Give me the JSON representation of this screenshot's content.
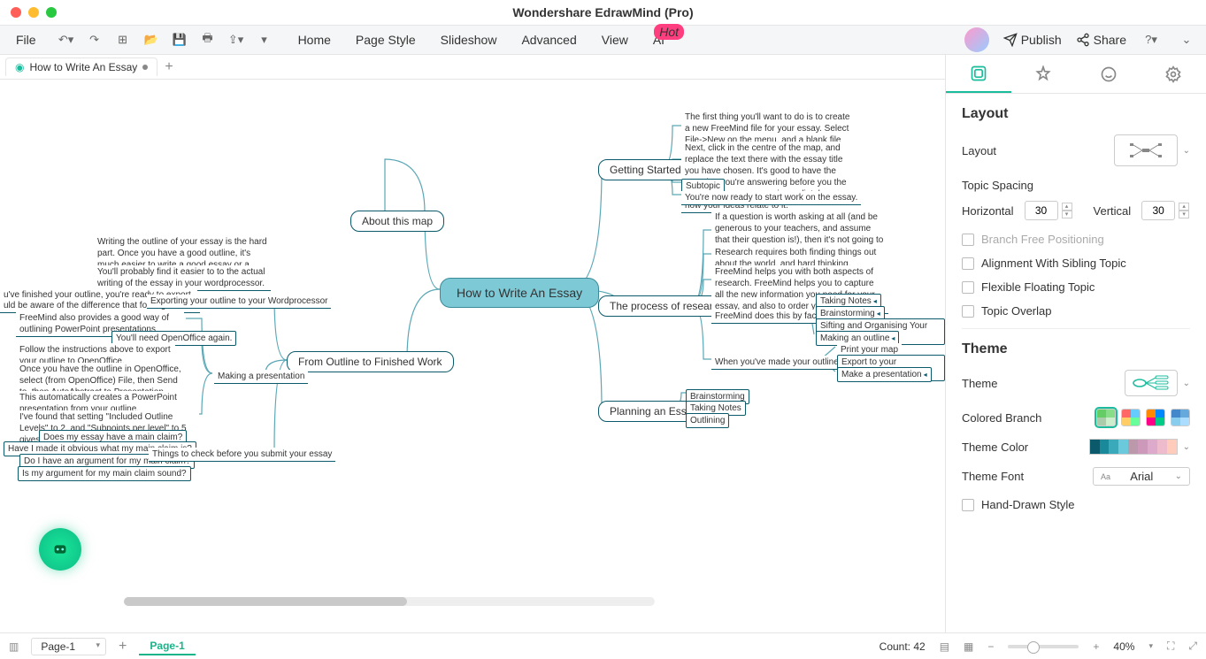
{
  "app_title": "Wondershare EdrawMind (Pro)",
  "toolbar": {
    "file": "File",
    "menu": [
      "Home",
      "Page Style",
      "Slideshow",
      "Advanced",
      "View",
      "AI"
    ],
    "hot": "Hot",
    "publish": "Publish",
    "share": "Share"
  },
  "tab": {
    "title": "How to Write An Essay"
  },
  "map": {
    "center": "How to Write An Essay",
    "about": "About this map",
    "outline": "From Outline to Finished Work",
    "getting": "Getting Started",
    "process": "The process of research",
    "planning": "Planning an Essay",
    "left": {
      "l1": "Writing the outline of your essay is the hard part. Once you have a good outline, it's much easier to write a good essay or a good presentation.",
      "l2": "You'll probably find it easier to to the actual writing of the essay in your wordprocessor.",
      "l3": "u've finished your outline, you're ready to export.",
      "l3b": "uld be aware of the difference that folding makes.",
      "l4": "Exporting your outline to your Wordprocessor",
      "l5": "FreeMind also provides a good way of outlining PowerPoint presentations.",
      "l6": "You'll need OpenOffice again.",
      "l7": "Follow the instructions above to export your outline to OpenOffice.",
      "l8": "Once you have the outline in OpenOffice, select (from OpenOffice) File, then Send to, then AutoAbstract to Presentation.",
      "l9": "This automatically creates a PowerPoint presentation from your outline.",
      "l10": "I've found that setting \"Included Outline Levels\" to 2, and \"Subpoints per level\" to 5 gives the best results.",
      "lmp": "Making a presentation",
      "q1": "Does my essay have a main claim?",
      "q2": "Have I made it obvious what my main claim is?",
      "q3": "Do I have an argument for my main claim?",
      "q4": "Is my argument for my main claim sound?",
      "check": "Things to check before you submit your essay"
    },
    "right": {
      "g1": "The first thing you'll want to do is to create a new FreeMind file for your essay. Select File->New on the menu, and a blank file will appear.",
      "g2": "Next, click in the centre of the map, and replace the text there with the essay title you have chosen. It's good to have the question you're answering before you the whole time, so you can immediately see how your ideas relate to it.",
      "g3": "Subtopic",
      "g4": "You're now ready to start work on the essay.",
      "p1": "If a question is worth asking at all (and be generous to your teachers, and assume that their question is!), then it's not going to have the kind of answer that you can just make up on the spot. It will require research.",
      "p2": "Research requires both finding things out about the world, and hard thinking.",
      "p3": "FreeMind helps you with both aspects of research. FreeMind helps you to capture all the new information you need for your essay, and also to order your thoughts.",
      "p4": "FreeMind does this by facilitating:",
      "p5": "When you've made your outline you can",
      "t1": "Taking Notes",
      "t2": "Brainstorming",
      "t3": "Sifting and Organising Your Ideas",
      "t4": "Making an outline",
      "e1": "Print your map",
      "e2": "Export to your wordprocessor",
      "e3": "Make a presentation",
      "pl1": "Brainstorming",
      "pl2": "Taking Notes",
      "pl3": "Outlining"
    }
  },
  "panel": {
    "layout_title": "Layout",
    "layout_label": "Layout",
    "topic_spacing": "Topic Spacing",
    "horizontal": "Horizontal",
    "h_val": "30",
    "vertical": "Vertical",
    "v_val": "30",
    "branch_free": "Branch Free Positioning",
    "align_sibling": "Alignment With Sibling Topic",
    "flex_float": "Flexible Floating Topic",
    "overlap": "Topic Overlap",
    "theme_title": "Theme",
    "theme_label": "Theme",
    "colored_branch": "Colored Branch",
    "theme_color": "Theme Color",
    "theme_font": "Theme Font",
    "font": "Arial",
    "hand_drawn": "Hand-Drawn Style"
  },
  "status": {
    "page": "Page-1",
    "page_tab": "Page-1",
    "count": "Count: 42",
    "zoom": "40%"
  }
}
